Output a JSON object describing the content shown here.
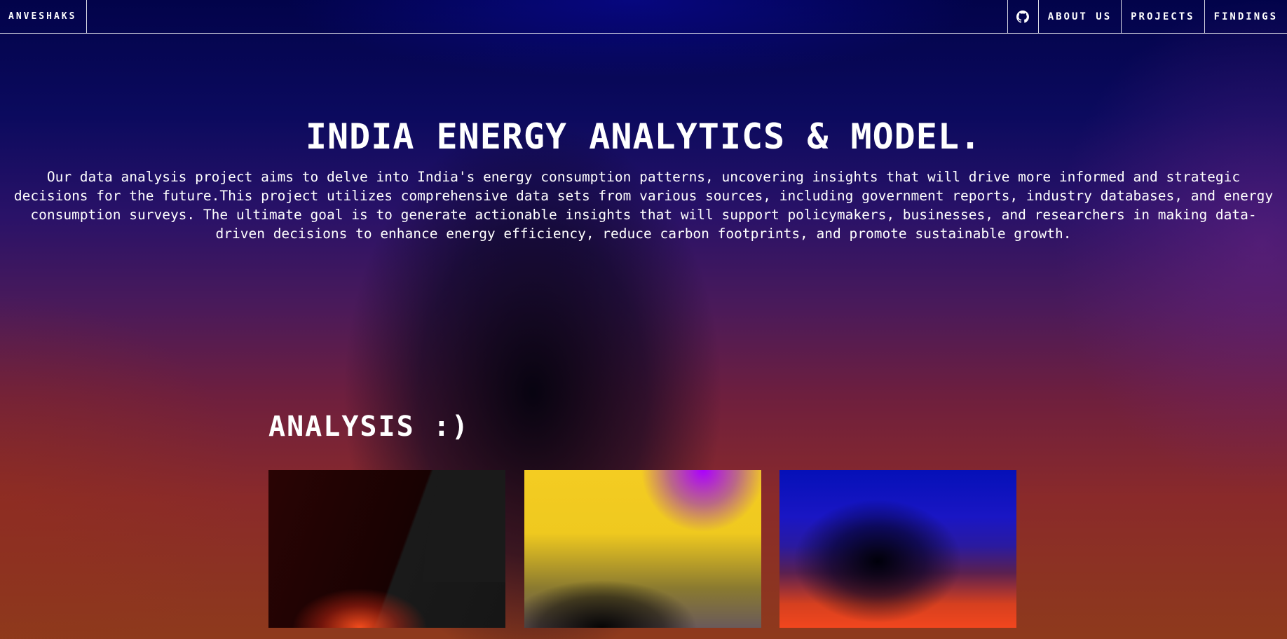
{
  "nav": {
    "brand": "ANVESHAKS",
    "github_icon": "github-icon",
    "links": [
      "ABOUT US",
      "PROJECTS",
      "FINDINGS"
    ]
  },
  "hero": {
    "title": "INDIA ENERGY ANALYTICS & MODEL.",
    "description": "Our data analysis project aims to delve into India's energy consumption patterns, uncovering insights that will drive more informed and strategic decisions for the future.This project utilizes comprehensive data sets from various sources, including government reports, industry databases, and energy consumption surveys. The ultimate goal is to generate actionable insights that will support policymakers, businesses, and researchers in making data-driven decisions to enhance energy efficiency, reduce carbon footprints, and promote sustainable growth."
  },
  "analysis": {
    "title": "ANALYSIS :)"
  },
  "colors": {
    "background_top": "#02034a",
    "background_bottom": "#8e3a1c",
    "text": "#ffffff"
  }
}
